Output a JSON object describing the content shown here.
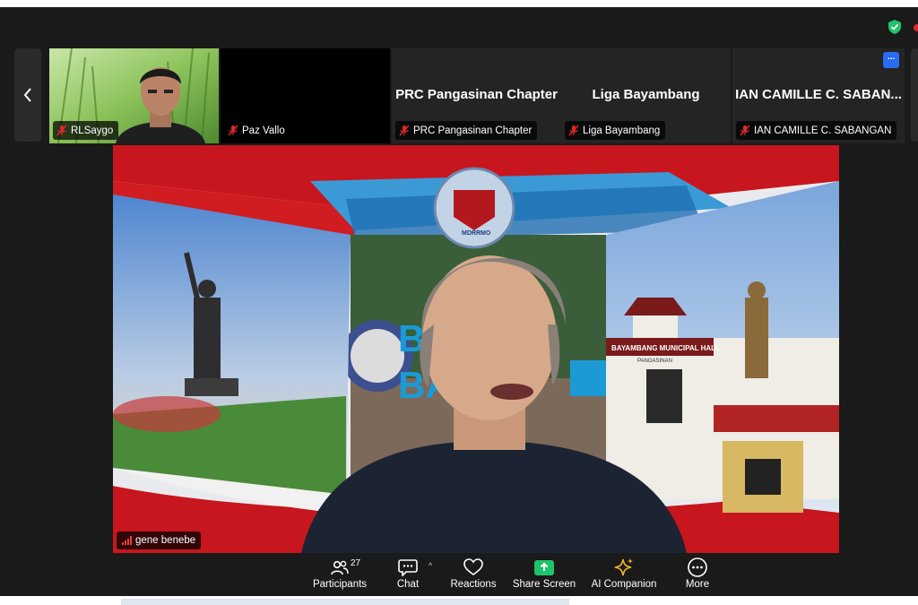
{
  "participants_strip": {
    "tiles": [
      {
        "name": "RLSaygo",
        "display": "",
        "muted": true
      },
      {
        "name": "Paz Vallo",
        "display": "",
        "muted": true
      },
      {
        "name": "PRC Pangasinan Chapter",
        "display": "PRC Pangasinan Chapter",
        "muted": true
      },
      {
        "name": "Liga Bayambang",
        "display": "Liga Bayambang",
        "muted": true
      },
      {
        "name": "IAN CAMILLE C. SABANGAN",
        "display": "IAN CAMILLE C. SABAN...",
        "muted": true
      }
    ],
    "menu_label": "..."
  },
  "main_video": {
    "speaker_name": "gene benebe",
    "scene_text": {
      "hall_sign": "BAYAMBANG MUNICIPAL HALL",
      "hall_subsign": "PANGASINAN",
      "letters_row1": "BA",
      "letters_row2": "BA",
      "seal_text": "MDRRMO"
    }
  },
  "toolbar": {
    "participants": {
      "label": "Participants",
      "count": "27"
    },
    "chat": {
      "label": "Chat"
    },
    "reactions": {
      "label": "Reactions"
    },
    "share": {
      "label": "Share Screen"
    },
    "ai": {
      "label": "AI Companion"
    },
    "more": {
      "label": "More"
    }
  },
  "colors": {
    "background": "#1a1a1a",
    "share_green": "#1fc36a",
    "accent_blue": "#2a6cf0",
    "muted_red": "#e02828",
    "ai_gold": "#f0b429"
  },
  "icons": {
    "prev": "chevron-left-icon",
    "mic": "mic-off-icon",
    "security": "shield-check-icon"
  }
}
